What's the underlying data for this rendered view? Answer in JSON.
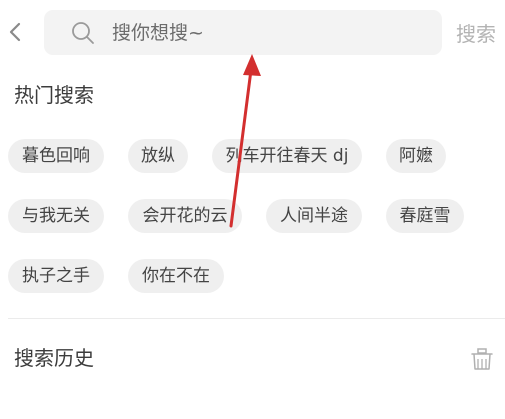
{
  "search": {
    "placeholder": "搜你想搜~",
    "button_label": "搜索"
  },
  "hot_section": {
    "title": "热门搜索",
    "tags": [
      "暮色回响",
      "放纵",
      "列车开往春天 dj",
      "阿嬷",
      "与我无关",
      "会开花的云",
      "人间半途",
      "春庭雪",
      "执子之手",
      "你在不在"
    ]
  },
  "history_section": {
    "title": "搜索历史"
  },
  "colors": {
    "annotation_arrow": "#d32f2f",
    "chip_bg": "#efefef",
    "search_bg": "#f3f3f3"
  },
  "icons": {
    "back": "chevron-left-icon",
    "search": "search-icon",
    "clear_history": "trash-icon"
  }
}
